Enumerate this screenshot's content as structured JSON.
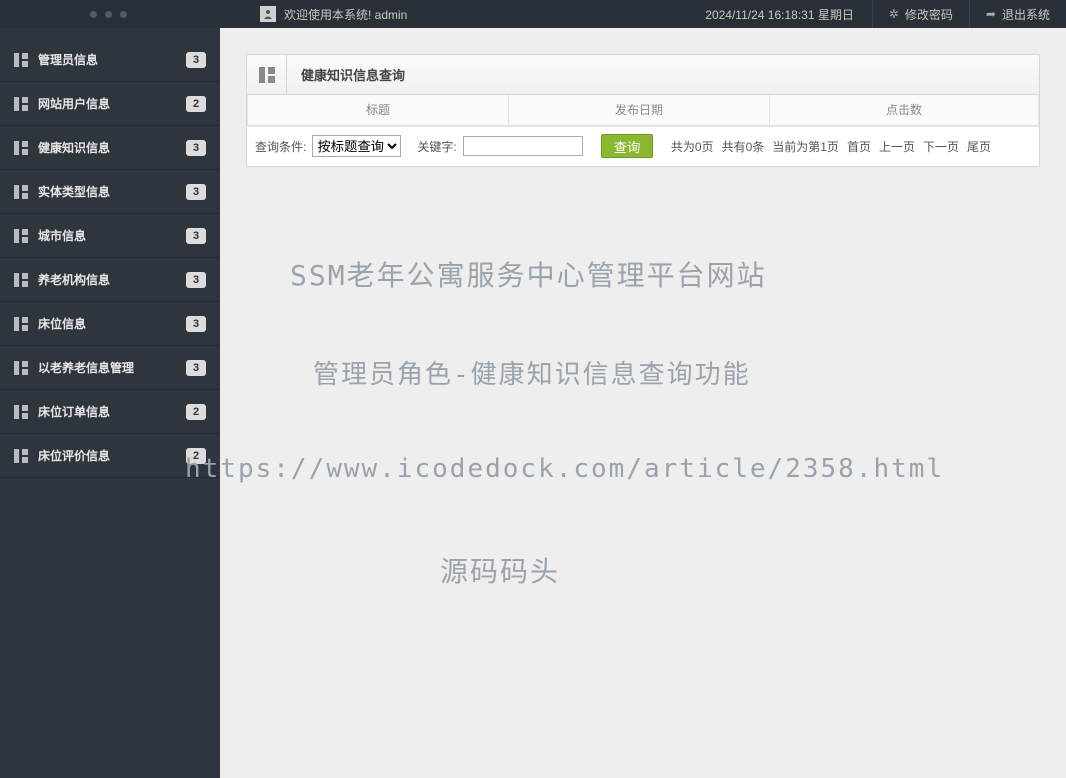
{
  "topbar": {
    "welcome": "欢迎使用本系统! admin",
    "datetime": "2024/11/24 16:18:31 星期日",
    "change_pw": "修改密码",
    "logout": "退出系统"
  },
  "sidebar": {
    "items": [
      {
        "label": "管理员信息",
        "badge": "3"
      },
      {
        "label": "网站用户信息",
        "badge": "2"
      },
      {
        "label": "健康知识信息",
        "badge": "3"
      },
      {
        "label": "实体类型信息",
        "badge": "3"
      },
      {
        "label": "城市信息",
        "badge": "3"
      },
      {
        "label": "养老机构信息",
        "badge": "3"
      },
      {
        "label": "床位信息",
        "badge": "3"
      },
      {
        "label": "以老养老信息管理",
        "badge": "3"
      },
      {
        "label": "床位订单信息",
        "badge": "2"
      },
      {
        "label": "床位评价信息",
        "badge": "2"
      }
    ]
  },
  "panel": {
    "title": "健康知识信息查询",
    "columns": {
      "c1": "标题",
      "c2": "发布日期",
      "c3": "点击数"
    },
    "query_label": "查询条件:",
    "select_option": "按标题查询",
    "keyword_label": "关键字:",
    "keyword_value": "",
    "search_btn": "查询",
    "pager": {
      "pages": "共为0页",
      "count": "共有0条",
      "current": "当前为第1页",
      "first": "首页",
      "prev": "上一页",
      "next": "下一页",
      "last": "尾页"
    }
  },
  "watermark": {
    "line1": "SSM老年公寓服务中心管理平台网站",
    "line2": "管理员角色-健康知识信息查询功能",
    "line3": "https://www.icodedock.com/article/2358.html",
    "line4": "源码码头"
  }
}
